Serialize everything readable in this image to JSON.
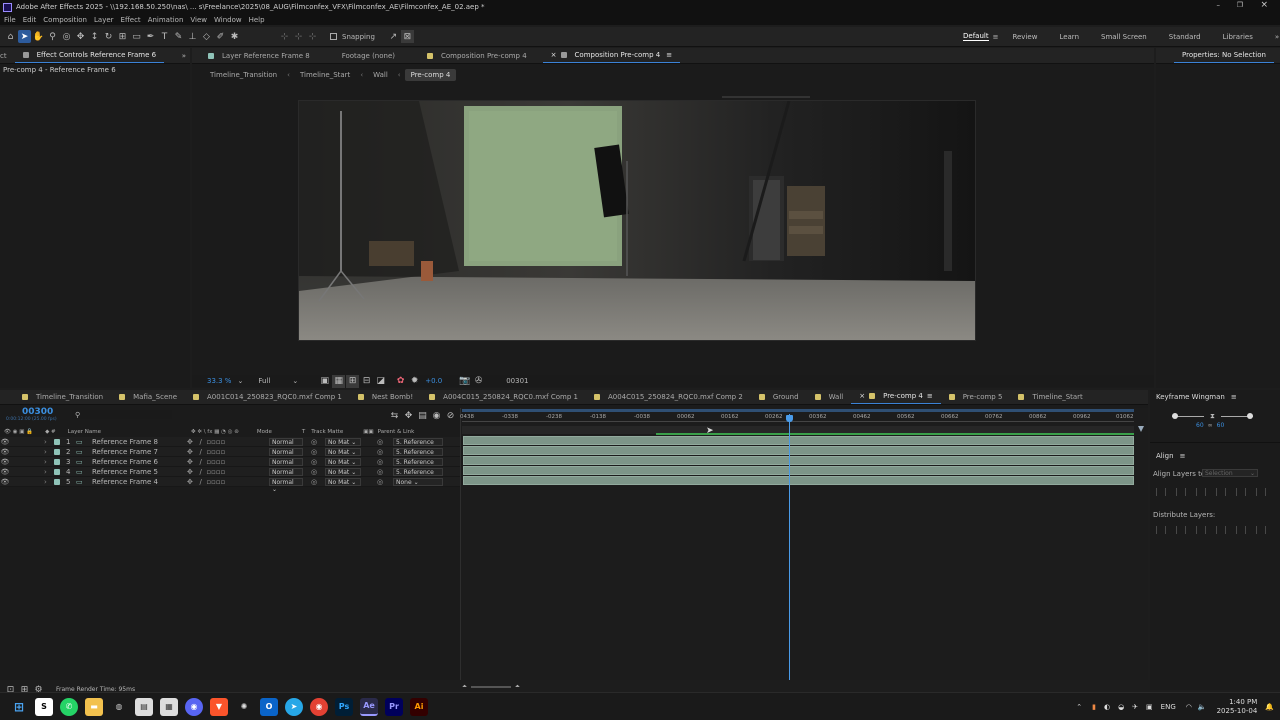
{
  "title": "Adobe After Effects 2025 - \\\\192.168.50.250\\nas\\ ... s\\Freelance\\2025\\08_AUG\\Filmconfex_VFX\\Filmconfex_AE\\Filmconfex_AE_02.aep *",
  "menu": [
    "File",
    "Edit",
    "Composition",
    "Layer",
    "Effect",
    "Animation",
    "View",
    "Window",
    "Help"
  ],
  "snapping": "Snapping",
  "workspaces": [
    "Default",
    "Review",
    "Learn",
    "Small Screen",
    "Standard",
    "Libraries"
  ],
  "left_panel": {
    "tab_stub": "ct",
    "tab": "Effect Controls Reference Frame 6",
    "subtitle": "Pre-comp 4 - Reference Frame 6"
  },
  "viewer_tabs": [
    "Layer Reference Frame 8",
    "Footage (none)",
    "Composition Pre-comp 4",
    "Composition Pre-comp 4"
  ],
  "breadcrumbs": [
    "Timeline_Transition",
    "Timeline_Start",
    "Wall",
    "Pre-comp 4"
  ],
  "viewer_controls": {
    "zoom": "33.3 %",
    "resolution": "Full",
    "exposure": "+0.0",
    "frame": "00301"
  },
  "right_panel": {
    "properties": "Properties: No Selection",
    "keyframe_wingman": "Keyframe Wingman",
    "kw_left": "60",
    "kw_right": "60",
    "align": "Align",
    "align_layers_to": "Align Layers to:",
    "selection": "Selection",
    "distribute": "Distribute Layers:"
  },
  "timeline_tabs": [
    "Timeline_Transition",
    "Mafia_Scene",
    "A001C014_250823_RQC0.mxf Comp 1",
    "Nest Bomb!",
    "A004C015_250824_RQC0.mxf Comp 1",
    "A004C015_250824_RQC0.mxf Comp 2",
    "Ground",
    "Wall",
    "Pre-comp 4",
    "Pre-comp 5",
    "Timeline_Start"
  ],
  "timecode": "00300",
  "timecode_sub": "0:00:12:00 (25.00 fps)",
  "columns": {
    "layer_name": "Layer Name",
    "mode": "Mode",
    "t": "T",
    "track_matte": "Track Matte",
    "parent": "Parent & Link"
  },
  "layers": [
    {
      "num": "1",
      "name": "Reference Frame 8",
      "mode": "Normal",
      "matte": "No Mat",
      "parent": "5. Reference"
    },
    {
      "num": "2",
      "name": "Reference Frame 7",
      "mode": "Normal",
      "matte": "No Mat",
      "parent": "5. Reference"
    },
    {
      "num": "3",
      "name": "Reference Frame 6",
      "mode": "Normal",
      "matte": "No Mat",
      "parent": "5. Reference"
    },
    {
      "num": "4",
      "name": "Reference Frame 5",
      "mode": "Normal",
      "matte": "No Mat",
      "parent": "5. Reference"
    },
    {
      "num": "5",
      "name": "Reference Frame 4",
      "mode": "Normal",
      "matte": "No Mat",
      "parent": "None"
    }
  ],
  "ruler": [
    "0438",
    "-0338",
    "-0238",
    "-0138",
    "-0038",
    "00062",
    "00162",
    "00262",
    "00362",
    "00462",
    "00562",
    "00662",
    "00762",
    "00862",
    "00962",
    "01062"
  ],
  "status": "Frame Render Time: 95ms",
  "clock": {
    "time": "1:40 PM",
    "date": "2025-10-04",
    "lang": "ENG"
  },
  "taskbar_apps": [
    "Windows",
    "Search",
    "WhatsApp",
    "Explorer",
    "Copilot",
    "Bookmark",
    "Discord",
    "Brave",
    "ChatGPT",
    "Outlook",
    "Telegram",
    "Chrome",
    "Ps",
    "Ae",
    "Pr",
    "Ai"
  ]
}
